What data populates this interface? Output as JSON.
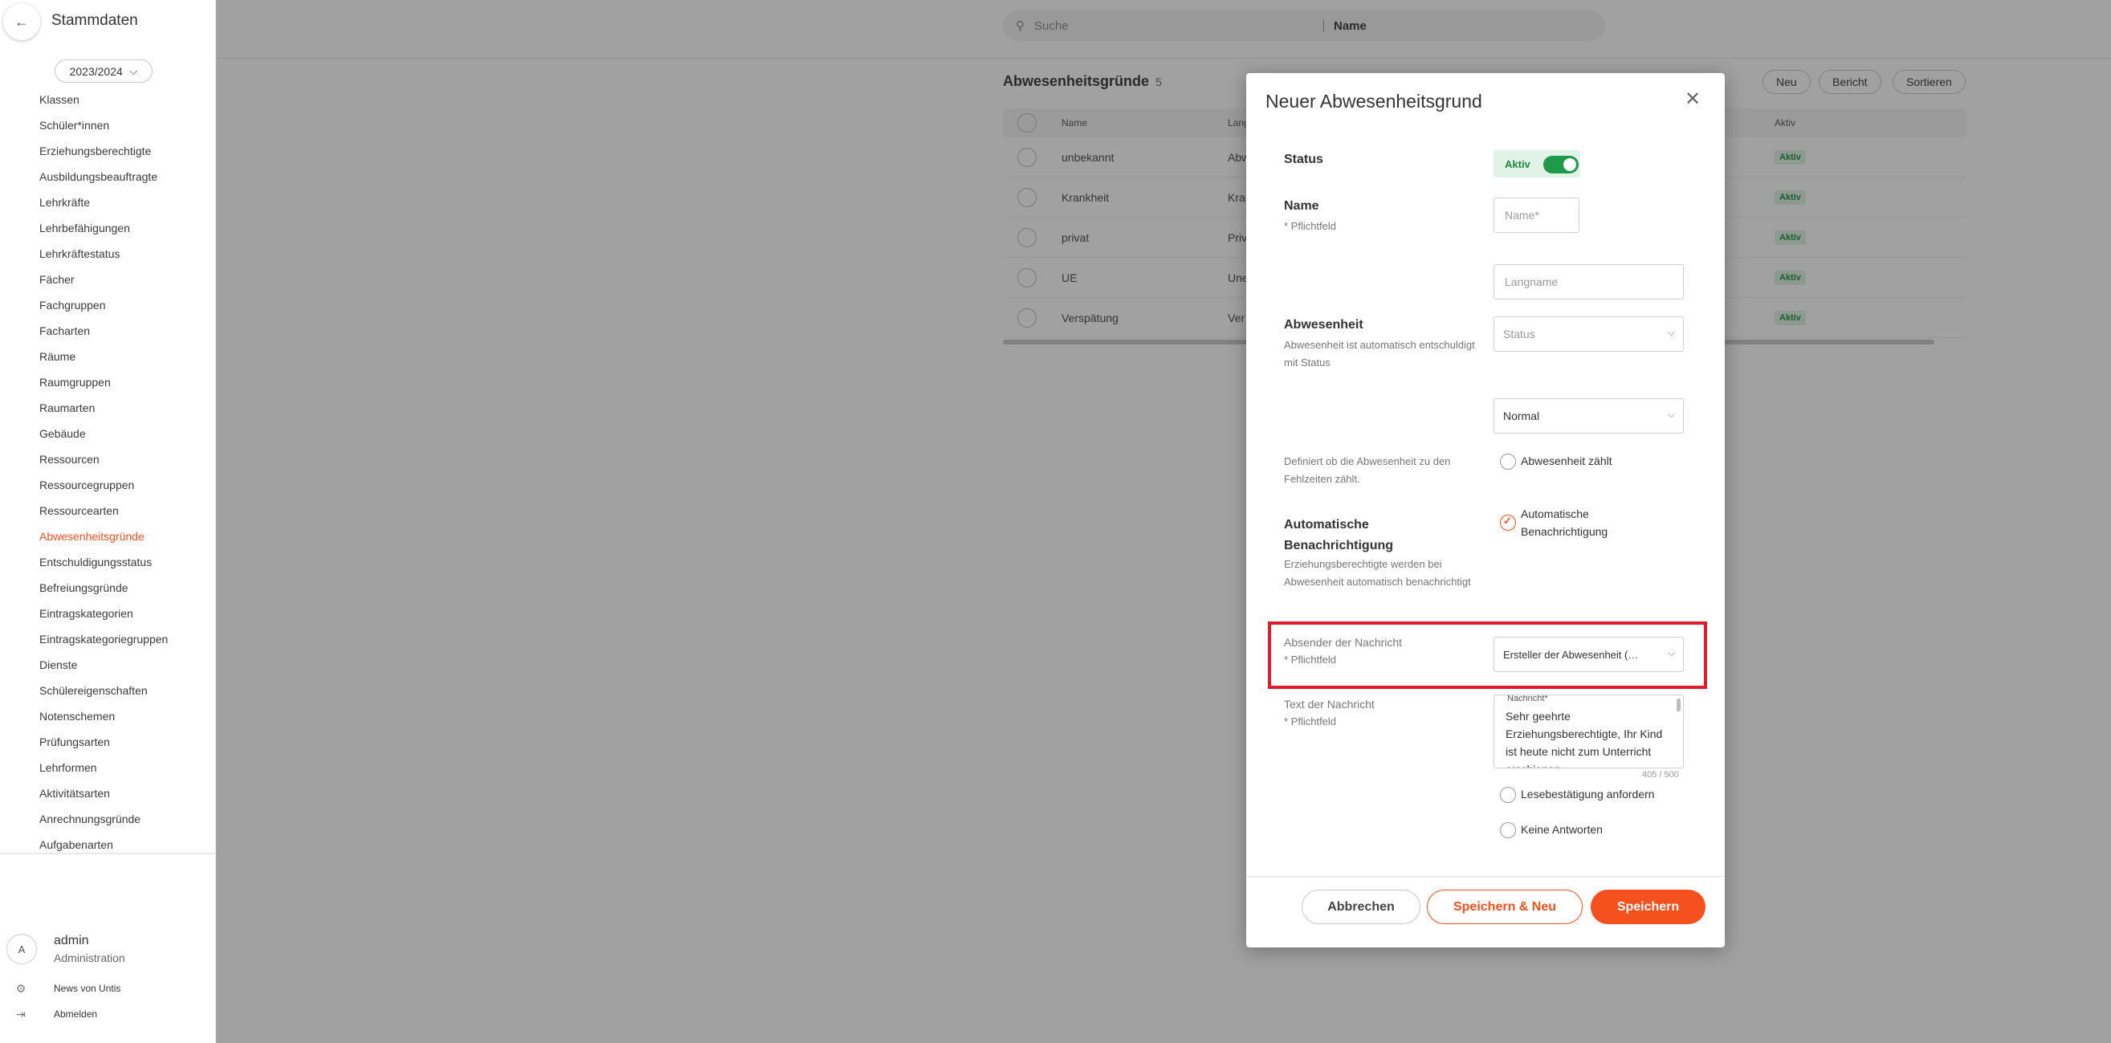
{
  "sidebar": {
    "title": "Stammdaten",
    "back_icon": "arrow-left-icon",
    "year": "2023/2024",
    "items": [
      {
        "label": "Klassen"
      },
      {
        "label": "Schüler*innen"
      },
      {
        "label": "Erziehungsberechtigte"
      },
      {
        "label": "Ausbildungsbeauftragte"
      },
      {
        "label": "Lehrkräfte"
      },
      {
        "label": "Lehrbefähigungen"
      },
      {
        "label": "Lehrkräftestatus"
      },
      {
        "label": "Fächer"
      },
      {
        "label": "Fachgruppen"
      },
      {
        "label": "Facharten"
      },
      {
        "label": "Räume"
      },
      {
        "label": "Raumgruppen"
      },
      {
        "label": "Raumarten"
      },
      {
        "label": "Gebäude"
      },
      {
        "label": "Ressourcen"
      },
      {
        "label": "Ressourcegruppen"
      },
      {
        "label": "Ressourcearten"
      },
      {
        "label": "Abwesenheitsgründe"
      },
      {
        "label": "Entschuldigungsstatus"
      },
      {
        "label": "Befreiungsgründe"
      },
      {
        "label": "Eintragskategorien"
      },
      {
        "label": "Eintragskategoriegruppen"
      },
      {
        "label": "Dienste"
      },
      {
        "label": "Schülereigenschaften"
      },
      {
        "label": "Notenschemen"
      },
      {
        "label": "Prüfungsarten"
      },
      {
        "label": "Lehrformen"
      },
      {
        "label": "Aktivitätsarten"
      },
      {
        "label": "Anrechnungsgründe"
      },
      {
        "label": "Aufgabenarten"
      }
    ],
    "active_index": 17,
    "active_color": "#f4511e",
    "user": {
      "initial": "A",
      "name": "admin",
      "role": "Administration"
    },
    "news_label": "News von Untis",
    "logout_label": "Abmelden"
  },
  "topbar": {
    "search_placeholder": "Suche",
    "search_field": "Name"
  },
  "list": {
    "title": "Abwesenheitsgründe",
    "count": "5",
    "buttons": {
      "new": "Neu",
      "report": "Bericht",
      "sort": "Sortieren"
    },
    "columns": {
      "name": "Name",
      "lang": "Lang",
      "aktiv": "Aktiv"
    },
    "rows": [
      {
        "name": "unbekannt",
        "lang": "Abw",
        "aktiv": "Aktiv"
      },
      {
        "name": "Krankheit",
        "lang": "Kran",
        "aktiv": "Aktiv"
      },
      {
        "name": "privat",
        "lang": "Priv",
        "aktiv": "Aktiv"
      },
      {
        "name": "UE",
        "lang": "Une",
        "aktiv": "Aktiv"
      },
      {
        "name": "Verspätung",
        "lang": "Ver",
        "aktiv": "Aktiv"
      }
    ]
  },
  "modal": {
    "title": "Neuer Abwesenheitsgrund",
    "status_label": "Status",
    "status_toggle": "Aktiv",
    "name_label": "Name",
    "required": "* Pflichtfeld",
    "name_placeholder": "Name*",
    "langname_placeholder": "Langname",
    "abwesenheit_label": "Abwesenheit",
    "abwesenheit_sub": "Abwesenheit ist automatisch entschuldigt mit Status",
    "status_select_placeholder": "Status",
    "normal_select": "Normal",
    "fehlzeiten_sub": "Definiert ob die Abwesenheit zu den Fehlzeiten zählt.",
    "abwesenheit_zaehlt": "Abwesenheit zählt",
    "auto_label": "Automatische Benachrichtigung",
    "auto_sub": "Erziehungsberechtigte werden bei Abwesenheit automatisch benachrichtigt",
    "auto_radio": "Automatische Benachrichtigung",
    "absender_label": "Absender der Nachricht",
    "absender_value": "Ersteller der Abwesenheit (…",
    "text_label": "Text der Nachricht",
    "nachricht_label": "Nachricht*",
    "nachricht_text": "Sehr geehrte Erziehungsberechtigte, Ihr Kind ist heute nicht zum Unterricht erschienen.",
    "counter": "405 / 500",
    "lesebestaetigung": "Lesebestätigung anfordern",
    "keine_antworten": "Keine Antworten",
    "btn_cancel": "Abbrechen",
    "btn_save_new": "Speichern & Neu",
    "btn_save": "Speichern",
    "accent": "#f4511e",
    "highlight_color": "#e21b2a"
  }
}
